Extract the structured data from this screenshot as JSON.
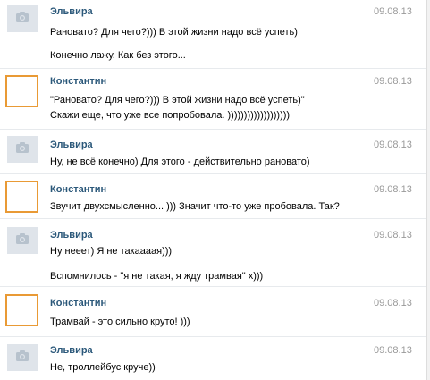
{
  "messages": [
    {
      "author": "Эльвира",
      "avatar_type": "camera-placeholder",
      "date": "09.08.13",
      "lines": [
        "Рановато? Для чего?))) В этой жизни надо всё успеть)",
        "Конечно лажу. Как без этого..."
      ]
    },
    {
      "author": "Константин",
      "avatar_type": "orange-frame",
      "date": "09.08.13",
      "lines": [
        "\"Рановато? Для чего?))) В этой жизни надо всё успеть)\"",
        "Скажи еще, что уже все попробовала. )))))))))))))))))))"
      ]
    },
    {
      "author": "Эльвира",
      "avatar_type": "camera-placeholder",
      "date": "09.08.13",
      "lines": [
        "Ну, не всё конечно) Для этого - действительно рановато)"
      ]
    },
    {
      "author": "Константин",
      "avatar_type": "orange-frame",
      "date": "09.08.13",
      "lines": [
        "Звучит двухсмысленно... ))) Значит что-то уже пробовала. Так?"
      ]
    },
    {
      "author": "Эльвира",
      "avatar_type": "camera-placeholder",
      "date": "09.08.13",
      "lines": [
        "Ну нееет) Я не такаааая)))",
        "Вспомнилось - \"я не такая, я жду трамвая\" х)))"
      ]
    },
    {
      "author": "Константин",
      "avatar_type": "orange-frame",
      "date": "09.08.13",
      "lines": [
        "Трамвай - это сильно круто! )))"
      ]
    },
    {
      "author": "Эльвира",
      "avatar_type": "camera-placeholder",
      "date": "09.08.13",
      "lines": [
        "Не, троллейбус круче))"
      ]
    }
  ],
  "colors": {
    "author": "#2b587a",
    "date": "#999999",
    "avatar_frame": "#e99a35",
    "avatar_placeholder": "#dfe4ea"
  }
}
